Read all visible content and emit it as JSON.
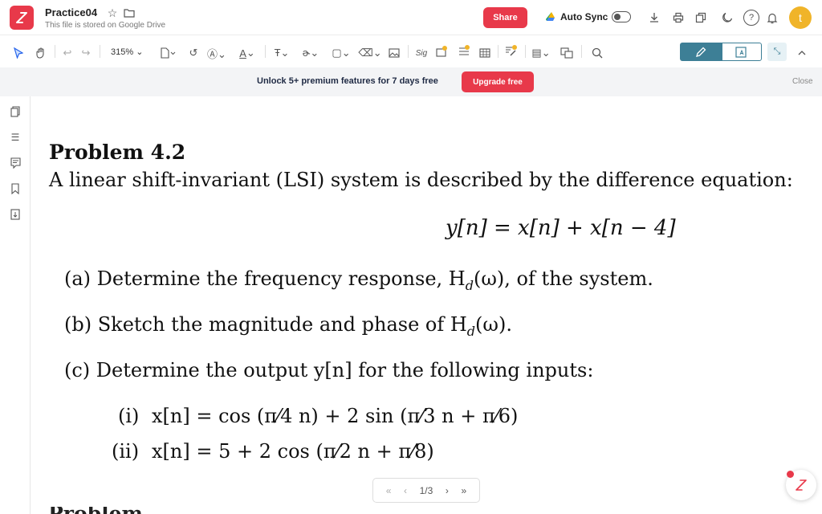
{
  "app": {
    "title": "Practice04",
    "subtitle": "This file is stored on Google Drive",
    "share_label": "Share",
    "autosync_label": "Auto Sync",
    "avatar_initial": "t",
    "brand_color": "#e8394a"
  },
  "toolbar": {
    "zoom": "315%"
  },
  "promo": {
    "text": "Unlock 5+ premium features for 7 days free",
    "upgrade_label": "Upgrade free",
    "close_label": "Close"
  },
  "doc": {
    "heading": "Problem 4.2",
    "intro": "A linear shift-invariant (LSI) system is described by the difference equation:",
    "equation": "y[n] = x[n] + x[n − 4]",
    "part_a": "(a)  Determine the frequency response, H",
    "part_a_sub": "d",
    "part_a_end": "(ω), of the system.",
    "part_b": "(b)  Sketch the magnitude and phase of H",
    "part_b_sub": "d",
    "part_b_end": "(ω).",
    "part_c": "(c)  Determine the output y[n] for the following inputs:",
    "input_i_label": "(i)",
    "input_i": "x[n] = cos (π⁄4 n) + 2 sin (π⁄3 n + π⁄6)",
    "input_ii_label": "(ii)",
    "input_ii": "x[n] = 5 + 2 cos (π⁄2 n + π⁄8)",
    "next_heading": "Problem"
  },
  "pager": {
    "label": "1/3"
  }
}
